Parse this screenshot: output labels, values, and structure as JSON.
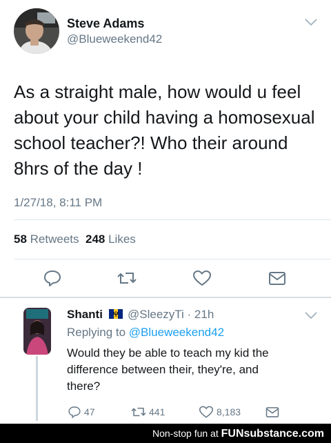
{
  "tweet": {
    "name": "Steve Adams",
    "handle": "@Blueweekend42",
    "text": "As a straight male, how would u feel\nabout your child having a homosexual\nschool teacher?! Who their around\n8hrs of the day !",
    "timestamp": "1/27/18, 8:11 PM",
    "retweets_count": "58",
    "retweets_label": "Retweets",
    "likes_count": "248",
    "likes_label": "Likes"
  },
  "reply": {
    "name": "Shanti",
    "handle_time": "@SleezyTi · 21h",
    "replying_prefix": "Replying to",
    "replying_to": "@Blueweekend42",
    "text": "Would they be able to teach my kid the\ndifference between their, they're, and\nthere?",
    "reply_count": "47",
    "retweet_count": "441",
    "like_count": "8,183"
  },
  "footer": {
    "tagline": "Non-stop fun at",
    "brand": "FUNsubstance.com"
  },
  "colors": {
    "text": "#14171a",
    "secondary": "#657786",
    "link": "#1da1f2",
    "divider": "#e1e8ed"
  },
  "icons": [
    "reply-icon",
    "retweet-icon",
    "like-icon",
    "share-icon",
    "chevron-down-icon",
    "barbados-flag-icon"
  ]
}
